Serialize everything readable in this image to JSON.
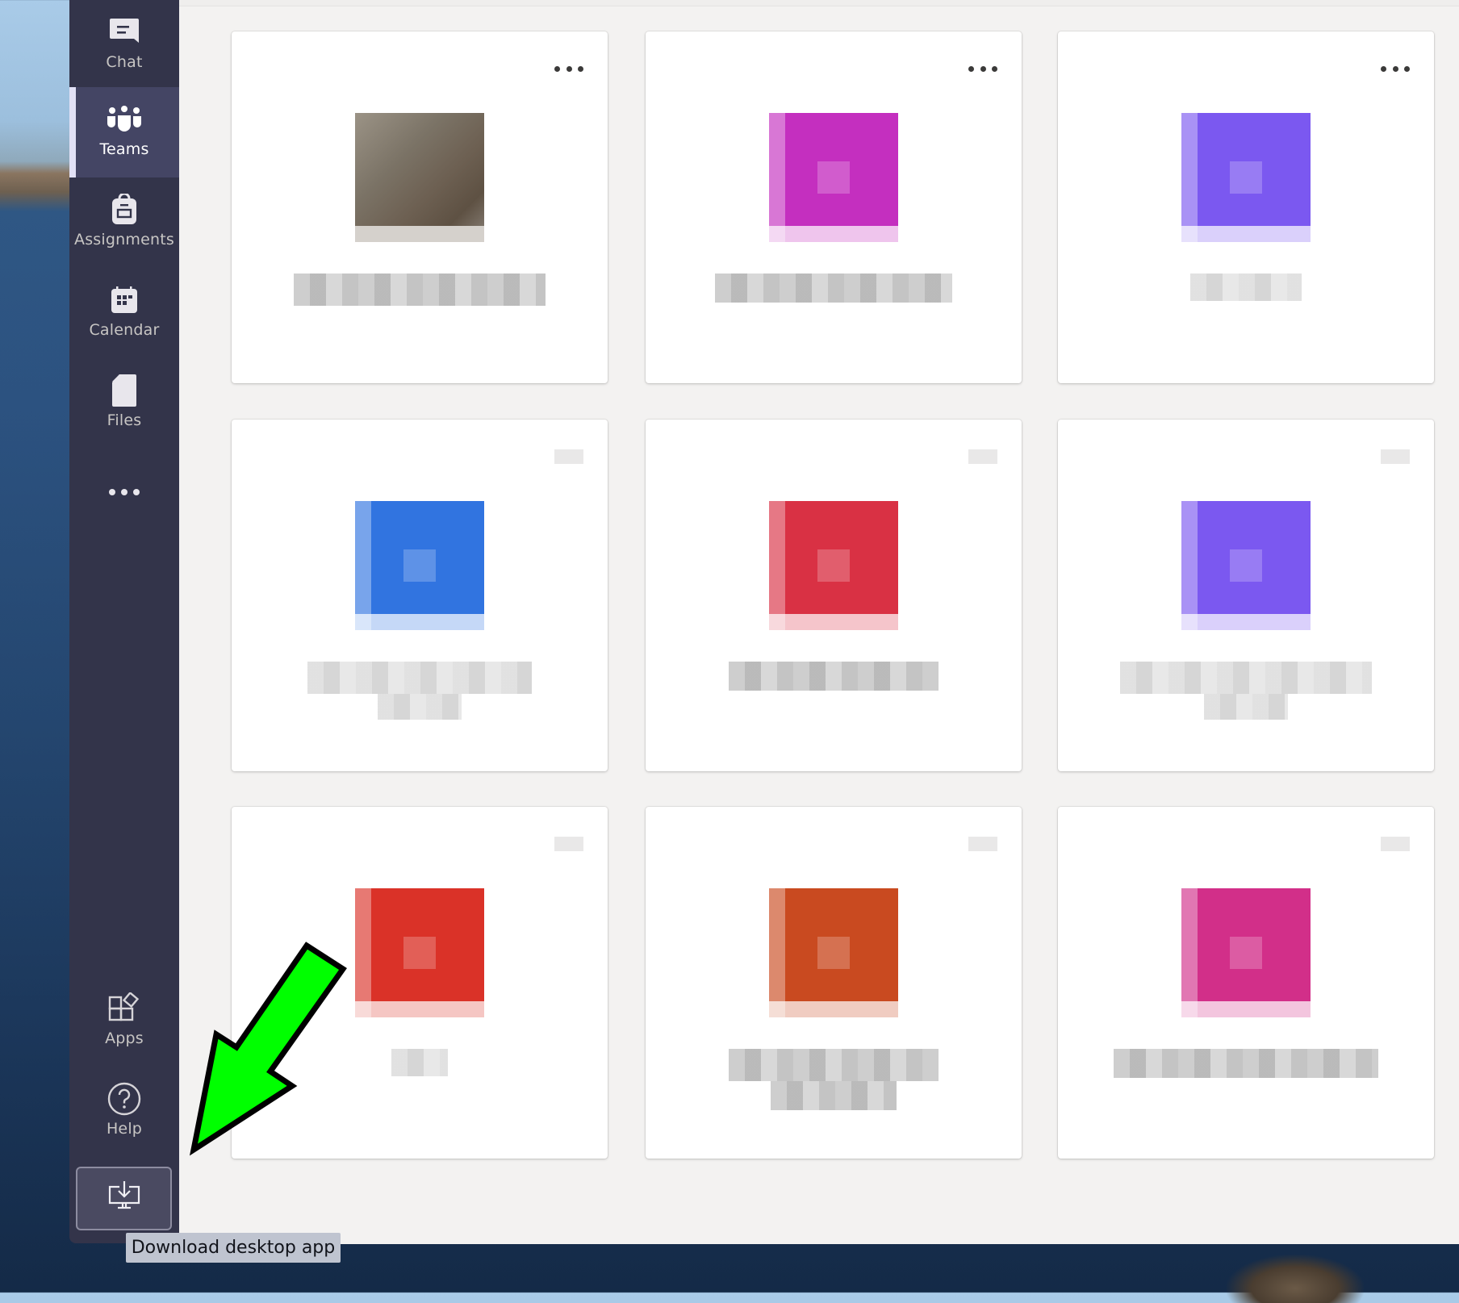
{
  "sidebar": {
    "items": [
      {
        "label": "Chat",
        "icon": "chat-icon",
        "active": false
      },
      {
        "label": "Teams",
        "icon": "teams-icon",
        "active": true
      },
      {
        "label": "Assignments",
        "icon": "assignments-icon",
        "active": false
      },
      {
        "label": "Calendar",
        "icon": "calendar-icon",
        "active": false
      },
      {
        "label": "Files",
        "icon": "files-icon",
        "active": false
      },
      {
        "label": "",
        "icon": "more-apps-icon",
        "active": false
      }
    ],
    "bottom": [
      {
        "label": "Apps",
        "icon": "apps-icon"
      },
      {
        "label": "Help",
        "icon": "help-icon"
      }
    ],
    "download": {
      "icon": "download-desktop-icon",
      "tooltip": "Download desktop app"
    }
  },
  "colors": {
    "rail": "#33344a",
    "rail_active": "#444564",
    "accent_indicator": "#e2e1f6",
    "content_bg": "#f3f2f1",
    "annotation_arrow": "#00ff00"
  },
  "teams": [
    {
      "name": "[redacted]",
      "logo": "photo",
      "color": "#7b7366",
      "more_icon": "more-options-icon"
    },
    {
      "name": "[redacted]",
      "logo": "tile",
      "color": "#c42fbf",
      "more_icon": "more-options-icon"
    },
    {
      "name": "[redacted]",
      "logo": "tile",
      "color": "#7b58f0",
      "more_icon": "more-options-icon"
    },
    {
      "name": "[redacted]",
      "logo": "tile",
      "color": "#3174e0",
      "more_icon": "more-options-icon"
    },
    {
      "name": "[redacted]",
      "logo": "tile",
      "color": "#d93144",
      "more_icon": "more-options-icon"
    },
    {
      "name": "[redacted]",
      "logo": "tile",
      "color": "#7b58f0",
      "more_icon": "more-options-icon"
    },
    {
      "name": "[redacted]",
      "logo": "tile",
      "color": "#da3228",
      "more_icon": "more-options-icon"
    },
    {
      "name": "[redacted]",
      "logo": "tile",
      "color": "#c94a20",
      "more_icon": "more-options-icon"
    },
    {
      "name": "[redacted]",
      "logo": "tile",
      "color": "#d22f89",
      "more_icon": "more-options-icon"
    }
  ],
  "annotation": {
    "type": "arrow",
    "points_to": "Download desktop app button"
  }
}
